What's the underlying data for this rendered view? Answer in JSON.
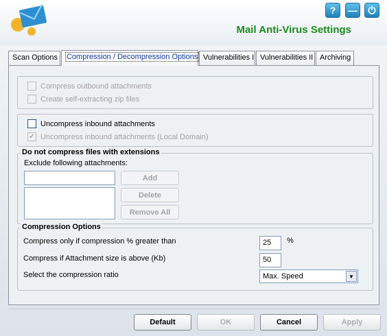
{
  "header": {
    "title": "Mail Anti-Virus Settings",
    "icons": [
      "envelope-logo-icon",
      "help-icon",
      "minimize-icon",
      "power-icon"
    ],
    "help_label": "?",
    "minimize_label": "—",
    "power_label": "⏻"
  },
  "tabs": [
    {
      "label": "Scan Options",
      "active": false
    },
    {
      "label": "Compression / Decompression Options",
      "active": true
    },
    {
      "label": "Vulnerabilities I",
      "active": false
    },
    {
      "label": "Vulnerabilities II",
      "active": false
    },
    {
      "label": "Archiving",
      "active": false
    }
  ],
  "compress_group": {
    "compress_outbound": {
      "label": "Compress outbound attachments",
      "checked": false,
      "enabled": false
    },
    "self_extracting": {
      "label": "Create self-extracting zip files",
      "checked": false,
      "enabled": false
    }
  },
  "uncompress_group": {
    "uncompress_inbound": {
      "label": "Uncompress inbound attachments",
      "checked": false,
      "enabled": true
    },
    "uncompress_local": {
      "label": "Uncompress inbound attachments (Local Domain)",
      "checked": true,
      "enabled": false
    }
  },
  "extensions_group": {
    "title": "Do not compress files with extensions",
    "exclude_label": "Exclude following attachments:",
    "add_label": "Add",
    "delete_label": "Delete",
    "remove_all_label": "Remove All",
    "input_value": ""
  },
  "compression_options": {
    "title": "Compression Options",
    "min_percent_label": "Compress only if compression % greater than",
    "min_percent_value": "25",
    "percent_unit": "%",
    "min_size_label": "Compress if Attachment size is above (Kb)",
    "min_size_value": "50",
    "ratio_label": "Select the compression ratio",
    "ratio_value": "Max. Speed"
  },
  "buttons": {
    "default": "Default",
    "ok": "OK",
    "cancel": "Cancel",
    "apply": "Apply"
  },
  "colors": {
    "title_green": "#1d8a1d",
    "active_tab_text": "#1a3fa6"
  }
}
